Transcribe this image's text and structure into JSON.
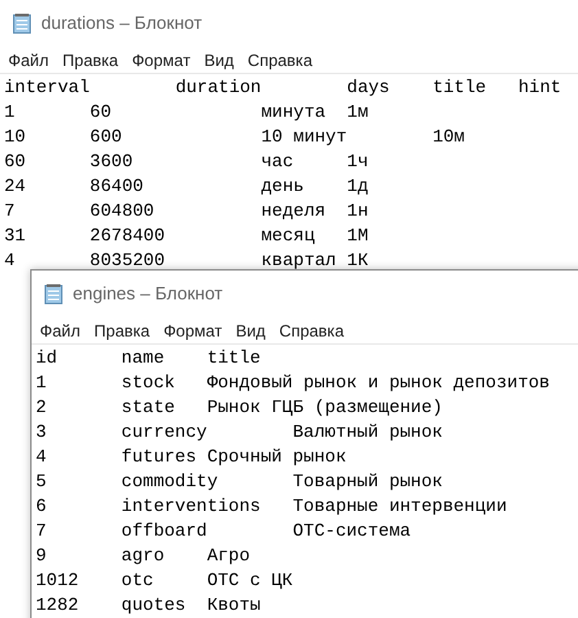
{
  "windows": [
    {
      "title": "durations – Блокнот",
      "menu": [
        "Файл",
        "Правка",
        "Формат",
        "Вид",
        "Справка"
      ],
      "lines": [
        "interval\tduration\tdays\ttitle\thint",
        "1\t60\t\tминута\t1м",
        "10\t600\t\t10 минут\t10м",
        "60\t3600\t\tчас\t1ч",
        "24\t86400\t\tдень\t1д",
        "7\t604800\t\tнеделя\t1н",
        "31\t2678400\t\tмесяц\t1М",
        "4\t8035200\t\tквартал\t1К"
      ]
    },
    {
      "title": "engines – Блокнот",
      "menu": [
        "Файл",
        "Правка",
        "Формат",
        "Вид",
        "Справка"
      ],
      "lines": [
        "id\tname\ttitle",
        "1\tstock\tФондовый рынок и рынок депозитов",
        "2\tstate\tРынок ГЦБ (размещение)",
        "3\tcurrency\tВалютный рынок",
        "4\tfutures Срочный рынок",
        "5\tcommodity\tТоварный рынок",
        "6\tinterventions\tТоварные интервенции",
        "7\toffboard\tОТС-система",
        "9\tagro\tАгро",
        "1012\totc\tОТС с ЦК",
        "1282\tquotes\tКвоты"
      ]
    }
  ]
}
